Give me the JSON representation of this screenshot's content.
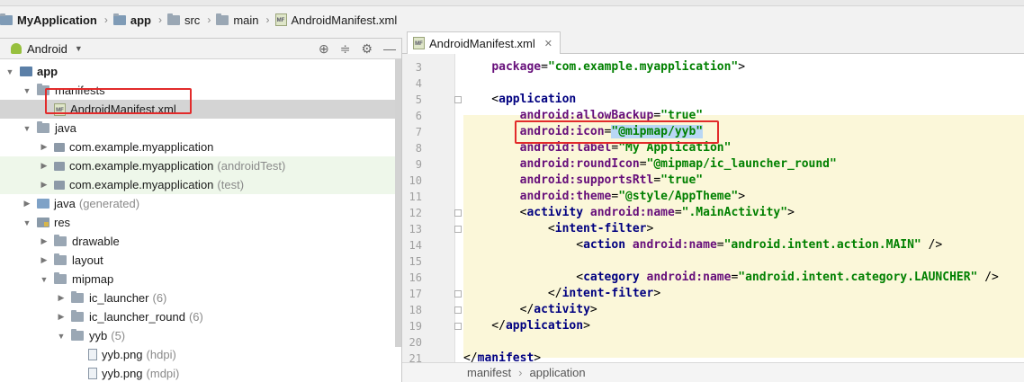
{
  "breadcrumbs": [
    {
      "label": "MyApplication",
      "bold": true
    },
    {
      "label": "app",
      "bold": true
    },
    {
      "label": "src",
      "bold": false
    },
    {
      "label": "main",
      "bold": false
    },
    {
      "label": "AndroidManifest.xml",
      "bold": false
    }
  ],
  "project_panel": {
    "view_label": "Android",
    "tree": [
      {
        "label": "app",
        "hint": "",
        "depth": 0,
        "expanded": true,
        "icon": "module-folder-icon"
      },
      {
        "label": "manifests",
        "hint": "",
        "depth": 1,
        "expanded": true,
        "icon": "folder-icon"
      },
      {
        "label": "AndroidManifest.xml",
        "hint": "",
        "depth": 2,
        "expanded": null,
        "icon": "manifest-file-icon",
        "selected": true
      },
      {
        "label": "java",
        "hint": "",
        "depth": 1,
        "expanded": true,
        "icon": "folder-icon"
      },
      {
        "label": "com.example.myapplication",
        "hint": "",
        "depth": 2,
        "expanded": false,
        "icon": "package-icon"
      },
      {
        "label": "com.example.myapplication",
        "hint": "(androidTest)",
        "depth": 2,
        "expanded": false,
        "icon": "package-icon",
        "test": true
      },
      {
        "label": "com.example.myapplication",
        "hint": "(test)",
        "depth": 2,
        "expanded": false,
        "icon": "package-icon",
        "test": true
      },
      {
        "label": "java",
        "hint": "(generated)",
        "depth": 1,
        "expanded": false,
        "icon": "generated-folder-icon"
      },
      {
        "label": "res",
        "hint": "",
        "depth": 1,
        "expanded": true,
        "icon": "res-folder-icon"
      },
      {
        "label": "drawable",
        "hint": "",
        "depth": 2,
        "expanded": false,
        "icon": "folder-icon"
      },
      {
        "label": "layout",
        "hint": "",
        "depth": 2,
        "expanded": false,
        "icon": "folder-icon"
      },
      {
        "label": "mipmap",
        "hint": "",
        "depth": 2,
        "expanded": true,
        "icon": "folder-icon"
      },
      {
        "label": "ic_launcher",
        "hint": "(6)",
        "depth": 3,
        "expanded": false,
        "icon": "folder-icon"
      },
      {
        "label": "ic_launcher_round",
        "hint": "(6)",
        "depth": 3,
        "expanded": false,
        "icon": "folder-icon"
      },
      {
        "label": "yyb",
        "hint": "(5)",
        "depth": 3,
        "expanded": true,
        "icon": "folder-icon"
      },
      {
        "label": "yyb.png",
        "hint": "(hdpi)",
        "depth": 4,
        "expanded": null,
        "icon": "png-file-icon"
      },
      {
        "label": "yyb.png",
        "hint": "(mdpi)",
        "depth": 4,
        "expanded": null,
        "icon": "png-file-icon"
      }
    ]
  },
  "editor": {
    "tab_label": "AndroidManifest.xml",
    "lines": [
      {
        "n": "3",
        "parts": [
          [
            "plain",
            "    "
          ],
          [
            "attr",
            "package"
          ],
          [
            "plain",
            "="
          ],
          [
            "val",
            "\"com.example.myapplication\""
          ],
          [
            "plain",
            ">"
          ]
        ]
      },
      {
        "n": "4",
        "parts": []
      },
      {
        "n": "5",
        "parts": [
          [
            "plain",
            "    <"
          ],
          [
            "tag",
            "application"
          ]
        ]
      },
      {
        "n": "6",
        "parts": [
          [
            "plain",
            "        "
          ],
          [
            "attr",
            "android:allowBackup"
          ],
          [
            "plain",
            "="
          ],
          [
            "val",
            "\"true\""
          ]
        ]
      },
      {
        "n": "7",
        "parts": [
          [
            "plain",
            "        "
          ],
          [
            "attr",
            "android:icon"
          ],
          [
            "plain",
            "="
          ],
          [
            "val",
            "\"@mipmap/yyb\""
          ]
        ]
      },
      {
        "n": "8",
        "parts": [
          [
            "plain",
            "        "
          ],
          [
            "attr",
            "android:label"
          ],
          [
            "plain",
            "="
          ],
          [
            "val",
            "\"My Application\""
          ]
        ]
      },
      {
        "n": "9",
        "parts": [
          [
            "plain",
            "        "
          ],
          [
            "attr",
            "android:roundIcon"
          ],
          [
            "plain",
            "="
          ],
          [
            "val",
            "\"@mipmap/ic_launcher_round\""
          ]
        ]
      },
      {
        "n": "10",
        "parts": [
          [
            "plain",
            "        "
          ],
          [
            "attr",
            "android:supportsRtl"
          ],
          [
            "plain",
            "="
          ],
          [
            "val",
            "\"true\""
          ]
        ]
      },
      {
        "n": "11",
        "parts": [
          [
            "plain",
            "        "
          ],
          [
            "attr",
            "android:theme"
          ],
          [
            "plain",
            "="
          ],
          [
            "val",
            "\"@style/AppTheme\""
          ],
          [
            "plain",
            ">"
          ]
        ]
      },
      {
        "n": "12",
        "parts": [
          [
            "plain",
            "        <"
          ],
          [
            "tag",
            "activity "
          ],
          [
            "attr",
            "android:name"
          ],
          [
            "plain",
            "="
          ],
          [
            "val",
            "\".MainActivity\""
          ],
          [
            "plain",
            ">"
          ]
        ]
      },
      {
        "n": "13",
        "parts": [
          [
            "plain",
            "            <"
          ],
          [
            "tag",
            "intent-filter"
          ],
          [
            "plain",
            ">"
          ]
        ]
      },
      {
        "n": "14",
        "parts": [
          [
            "plain",
            "                <"
          ],
          [
            "tag",
            "action "
          ],
          [
            "attr",
            "android:name"
          ],
          [
            "plain",
            "="
          ],
          [
            "val",
            "\"android.intent.action.MAIN\""
          ],
          [
            "plain",
            " />"
          ]
        ]
      },
      {
        "n": "15",
        "parts": []
      },
      {
        "n": "16",
        "parts": [
          [
            "plain",
            "                <"
          ],
          [
            "tag",
            "category "
          ],
          [
            "attr",
            "android:name"
          ],
          [
            "plain",
            "="
          ],
          [
            "val",
            "\"android.intent.category.LAUNCHER\""
          ],
          [
            "plain",
            " />"
          ]
        ]
      },
      {
        "n": "17",
        "parts": [
          [
            "plain",
            "            </"
          ],
          [
            "tag",
            "intent-filter"
          ],
          [
            "plain",
            ">"
          ]
        ]
      },
      {
        "n": "18",
        "parts": [
          [
            "plain",
            "        </"
          ],
          [
            "tag",
            "activity"
          ],
          [
            "plain",
            ">"
          ]
        ]
      },
      {
        "n": "19",
        "parts": [
          [
            "plain",
            "    </"
          ],
          [
            "tag",
            "application"
          ],
          [
            "plain",
            ">"
          ]
        ]
      },
      {
        "n": "20",
        "parts": []
      },
      {
        "n": "21",
        "parts": [
          [
            "plain",
            "</"
          ],
          [
            "tag",
            "manifest"
          ],
          [
            "plain",
            ">"
          ]
        ]
      }
    ]
  },
  "status_breadcrumb": [
    "manifest",
    "application"
  ],
  "colors": {
    "highlight_block": "#fbf7d9",
    "annotation_box": "#e22b2b",
    "selection": "#d4d4d4"
  }
}
